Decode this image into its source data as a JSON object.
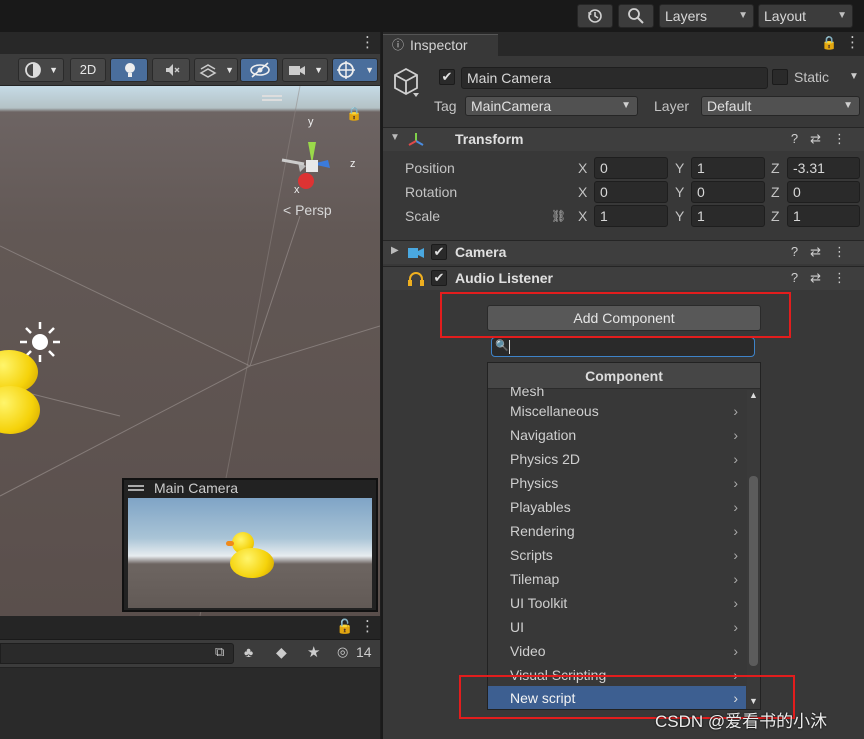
{
  "topbar": {
    "history_icon": "history-icon",
    "search_icon": "search-icon",
    "layers_label": "Layers",
    "layout_label": "Layout"
  },
  "scene": {
    "toolbar": {
      "mode_2d_label": "2D",
      "icons": [
        "shading-mode-icon",
        "lighting-icon",
        "audio-mute-icon",
        "effects-icon",
        "hidden-objects-icon",
        "camera-icon",
        "gizmos-icon"
      ]
    },
    "gizmo": {
      "axis_y": "y",
      "axis_z": "z",
      "axis_x": "x",
      "persp_label": "< Persp"
    },
    "camera_preview_title": "Main Camera"
  },
  "bottom_panel": {
    "hidden_count": "14"
  },
  "inspector": {
    "tab_label": "Inspector",
    "object_name": "Main Camera",
    "static_label": "Static",
    "tag_label": "Tag",
    "tag_value": "MainCamera",
    "layer_label": "Layer",
    "layer_value": "Default",
    "transform": {
      "title": "Transform",
      "rows": [
        {
          "label": "Position",
          "x": "0",
          "y": "1",
          "z": "-3.31"
        },
        {
          "label": "Rotation",
          "x": "0",
          "y": "0",
          "z": "0"
        },
        {
          "label": "Scale",
          "x": "1",
          "y": "1",
          "z": "1"
        }
      ],
      "axis_x": "X",
      "axis_y": "Y",
      "axis_z": "Z"
    },
    "camera_title": "Camera",
    "audio_listener_title": "Audio Listener",
    "add_component_label": "Add Component",
    "component_menu": {
      "header": "Component",
      "partial_item": "Mesh",
      "items": [
        "Miscellaneous",
        "Navigation",
        "Physics 2D",
        "Physics",
        "Playables",
        "Rendering",
        "Scripts",
        "Tilemap",
        "UI Toolkit",
        "UI",
        "Video",
        "Visual Scripting",
        "New script"
      ],
      "selected": "New script"
    }
  },
  "watermark": "CSDN @爱看书的小沐",
  "colors": {
    "accent_selected": "#3d5f91",
    "highlight_box": "#e21d1d",
    "search_focus": "#3e83c8"
  }
}
